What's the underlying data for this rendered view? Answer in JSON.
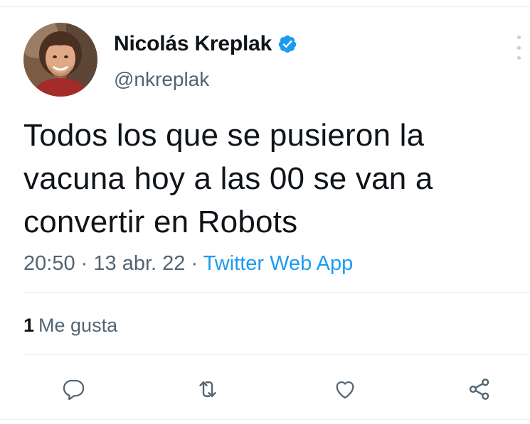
{
  "author": {
    "display_name": "Nicolás Kreplak",
    "handle": "@nkreplak",
    "verified": true
  },
  "tweet": {
    "text": "Todos los que se pusieron la\nvacuna hoy a las 00 se van a\nconvertir en Robots",
    "time": "20:50",
    "date": "13 abr. 22",
    "separator": "·",
    "source": "Twitter Web App"
  },
  "stats": {
    "likes_count": "1",
    "likes_label": "Me gusta"
  },
  "actions": {
    "reply_icon": "speech-bubble",
    "retweet_icon": "retweet-arrows",
    "like_icon": "heart-outline",
    "share_icon": "share-nodes"
  },
  "colors": {
    "text_primary": "#0f1419",
    "text_secondary": "#536471",
    "accent": "#1d9bf0",
    "divider": "#e6ecf0"
  }
}
